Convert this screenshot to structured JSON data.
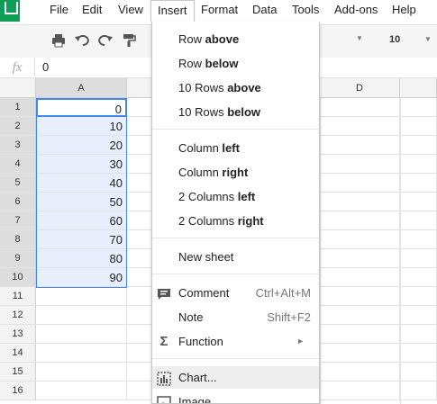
{
  "menubar": {
    "items": [
      "File",
      "Edit",
      "View",
      "Insert",
      "Format",
      "Data",
      "Tools",
      "Add-ons",
      "Help"
    ]
  },
  "toolbar": {
    "icons": [
      "print-icon",
      "undo-icon",
      "redo-icon",
      "paint-format-icon",
      "font-dropdown-arrow-icon"
    ],
    "font_size": "10"
  },
  "formula_bar": {
    "fx_label": "fx",
    "value": "0"
  },
  "grid": {
    "columns": [
      "A",
      "D"
    ],
    "rows": [
      "1",
      "2",
      "3",
      "4",
      "5",
      "6",
      "7",
      "8",
      "9",
      "10",
      "11",
      "12",
      "13",
      "14",
      "15",
      "16"
    ],
    "column_a_values": [
      "0",
      "10",
      "20",
      "30",
      "40",
      "50",
      "60",
      "70",
      "80",
      "90"
    ]
  },
  "insert_menu": {
    "row_above": {
      "pre": "Row ",
      "bold": "above"
    },
    "row_below": {
      "pre": "Row ",
      "bold": "below"
    },
    "rows_above": {
      "pre": "10 Rows ",
      "bold": "above"
    },
    "rows_below": {
      "pre": "10 Rows ",
      "bold": "below"
    },
    "column_left": {
      "pre": "Column ",
      "bold": "left"
    },
    "column_right": {
      "pre": "Column ",
      "bold": "right"
    },
    "columns_left": {
      "pre": "2 Columns ",
      "bold": "left"
    },
    "columns_right": {
      "pre": "2 Columns ",
      "bold": "right"
    },
    "new_sheet": "New sheet",
    "comment": {
      "label": "Comment",
      "shortcut": "Ctrl+Alt+M"
    },
    "note": {
      "label": "Note",
      "shortcut": "Shift+F2"
    },
    "function": {
      "label": "Function"
    },
    "chart": "Chart...",
    "image": "Image..."
  },
  "colors": {
    "selection_fill": "#e8eefb",
    "selection_border": "#4285f4",
    "menu_highlight": "#eeeeee",
    "sheets_green": "#0f9d58"
  }
}
